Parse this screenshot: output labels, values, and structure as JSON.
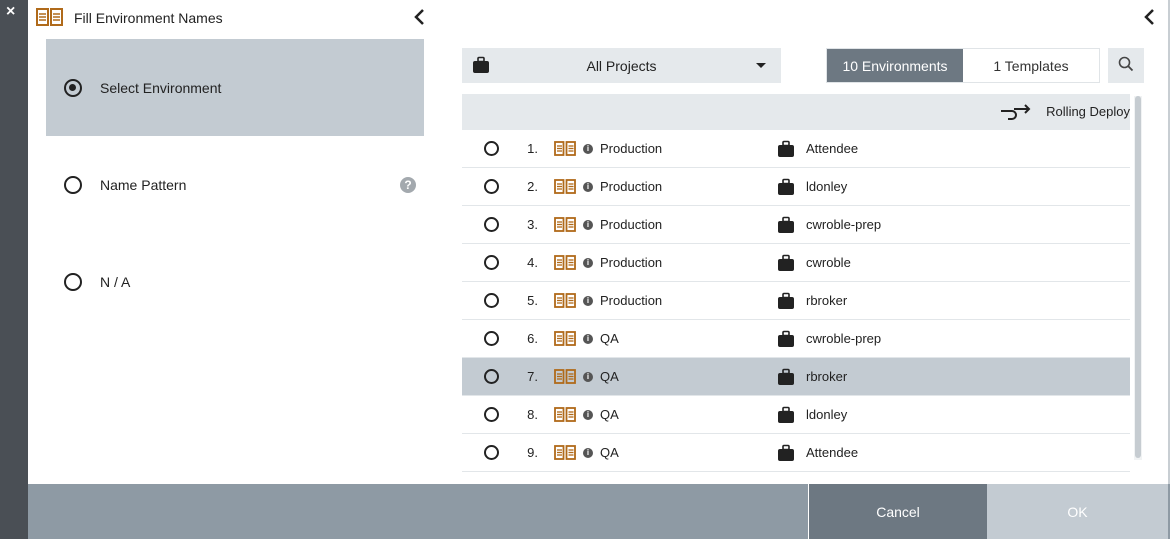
{
  "window": {
    "close_glyph": "×"
  },
  "left_panel": {
    "title": "Fill Environment Names",
    "icon": "env-columns-icon",
    "options": [
      {
        "label": "Select Environment",
        "checked": true
      },
      {
        "label": "Name Pattern",
        "checked": false,
        "help": "?"
      },
      {
        "label": "N / A",
        "checked": false
      }
    ]
  },
  "right_panel": {
    "project_filter": {
      "value": "All Projects",
      "icon": "briefcase-icon"
    },
    "tabs": [
      {
        "label": "10 Environments",
        "active": true
      },
      {
        "label": "1 Templates",
        "active": false
      }
    ],
    "table_header": {
      "deploy_label": "Rolling Deploy",
      "deploy_icon": "rolling-deploy-icon"
    },
    "rows": [
      {
        "num": "1.",
        "env": "Production",
        "project": "Attendee",
        "highlighted": false
      },
      {
        "num": "2.",
        "env": "Production",
        "project": "ldonley",
        "highlighted": false
      },
      {
        "num": "3.",
        "env": "Production",
        "project": "cwroble-prep",
        "highlighted": false
      },
      {
        "num": "4.",
        "env": "Production",
        "project": "cwroble",
        "highlighted": false
      },
      {
        "num": "5.",
        "env": "Production",
        "project": "rbroker",
        "highlighted": false
      },
      {
        "num": "6.",
        "env": "QA",
        "project": "cwroble-prep",
        "highlighted": false
      },
      {
        "num": "7.",
        "env": "QA",
        "project": "rbroker",
        "highlighted": true
      },
      {
        "num": "8.",
        "env": "QA",
        "project": "ldonley",
        "highlighted": false
      },
      {
        "num": "9.",
        "env": "QA",
        "project": "Attendee",
        "highlighted": false
      }
    ]
  },
  "footer": {
    "cancel_label": "Cancel",
    "ok_label": "OK"
  },
  "colors": {
    "accent_icon": "#b06a1a",
    "selected_bg": "#c3cbd2",
    "active_tab": "#6d7882",
    "footer_bg": "#8e9aa4"
  }
}
